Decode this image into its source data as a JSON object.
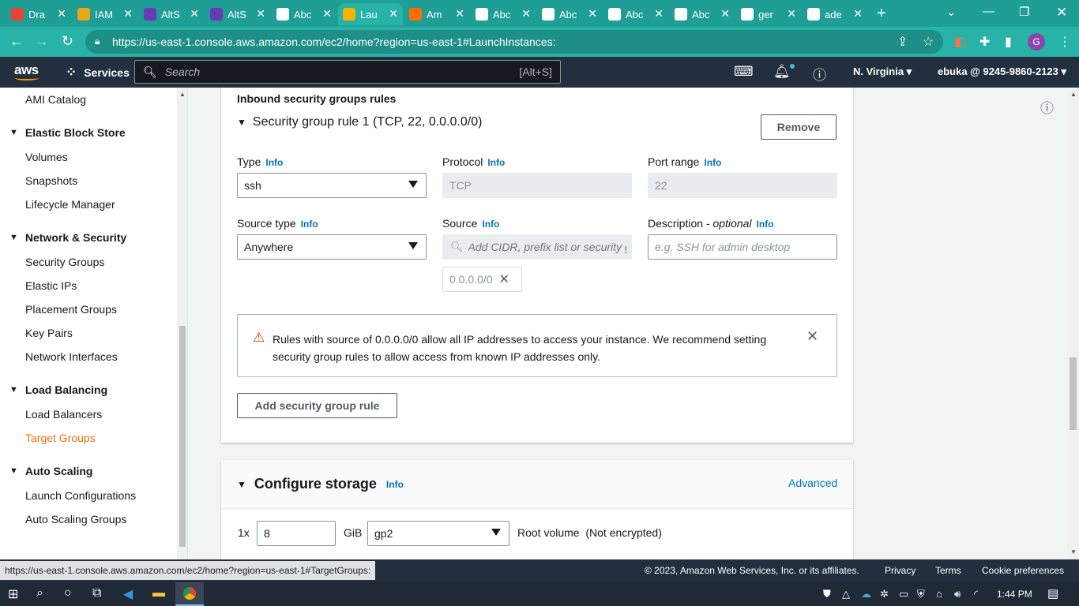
{
  "browser": {
    "tabs": [
      {
        "label": "Dra",
        "icon": "gmail-icon",
        "color": "#ea4335"
      },
      {
        "label": "IAM",
        "icon": "aws-iam-icon",
        "color": "#e6a817"
      },
      {
        "label": "AltS",
        "icon": "forms-icon",
        "color": "#673ab7"
      },
      {
        "label": "AltS",
        "icon": "forms-icon",
        "color": "#673ab7"
      },
      {
        "label": "Abc",
        "icon": "globe-icon",
        "color": "#ffffff"
      },
      {
        "label": "Lau",
        "icon": "aws-box-icon",
        "color": "#f4b400"
      },
      {
        "label": "Am",
        "icon": "aws-cube-icon",
        "color": "#ff6d00"
      },
      {
        "label": "Abc",
        "icon": "globe-icon",
        "color": "#ffffff"
      },
      {
        "label": "Abc",
        "icon": "globe-icon",
        "color": "#ffffff"
      },
      {
        "label": "Abc",
        "icon": "globe-icon",
        "color": "#ffffff"
      },
      {
        "label": "Abc",
        "icon": "globe-icon",
        "color": "#ffffff"
      },
      {
        "label": "ger",
        "icon": "google-icon",
        "color": "#ffffff"
      },
      {
        "label": "ade",
        "icon": "github-icon",
        "color": "#ffffff"
      }
    ],
    "active_tab_index": 5,
    "url": "https://us-east-1.console.aws.amazon.com/ec2/home?region=us-east-1#LaunchInstances:",
    "profile_initial": "G",
    "status_url": "https://us-east-1.console.aws.amazon.com/ec2/home?region=us-east-1#TargetGroups:"
  },
  "aws_header": {
    "logo": "aws",
    "services_label": "Services",
    "search_placeholder": "Search",
    "search_hint": "[Alt+S]",
    "region": "N. Virginia",
    "account": "ebuka @ 9245-9860-2123"
  },
  "sidebar": {
    "items": [
      {
        "type": "link",
        "label": "AMI Catalog"
      },
      {
        "type": "header",
        "label": "Elastic Block Store"
      },
      {
        "type": "link",
        "label": "Volumes"
      },
      {
        "type": "link",
        "label": "Snapshots"
      },
      {
        "type": "link",
        "label": "Lifecycle Manager"
      },
      {
        "type": "header",
        "label": "Network & Security"
      },
      {
        "type": "link",
        "label": "Security Groups"
      },
      {
        "type": "link",
        "label": "Elastic IPs"
      },
      {
        "type": "link",
        "label": "Placement Groups"
      },
      {
        "type": "link",
        "label": "Key Pairs"
      },
      {
        "type": "link",
        "label": "Network Interfaces"
      },
      {
        "type": "header",
        "label": "Load Balancing"
      },
      {
        "type": "link",
        "label": "Load Balancers"
      },
      {
        "type": "link",
        "label": "Target Groups",
        "active": true
      },
      {
        "type": "header",
        "label": "Auto Scaling"
      },
      {
        "type": "link",
        "label": "Launch Configurations"
      },
      {
        "type": "link",
        "label": "Auto Scaling Groups"
      }
    ]
  },
  "security": {
    "section_title": "Inbound security groups rules",
    "rule_title": "Security group rule 1 (TCP, 22, 0.0.0.0/0)",
    "remove_label": "Remove",
    "info_label": "Info",
    "type_label": "Type",
    "type_value": "ssh",
    "protocol_label": "Protocol",
    "protocol_value": "TCP",
    "port_label": "Port range",
    "port_value": "22",
    "source_type_label": "Source type",
    "source_type_value": "Anywhere",
    "source_label": "Source",
    "source_placeholder": "Add CIDR, prefix list or security group",
    "source_token": "0.0.0.0/0",
    "desc_label": "Description - ",
    "desc_optional": "optional",
    "desc_placeholder": "e.g. SSH for admin desktop",
    "warning_line1": "Rules with source of 0.0.0.0/0 allow all IP addresses to access your instance. We recommend setting",
    "warning_line2": "security group rules to allow access from known IP addresses only.",
    "add_rule_label": "Add security group rule"
  },
  "storage": {
    "title": "Configure storage",
    "info_label": "Info",
    "advanced_label": "Advanced",
    "count_prefix": "1x",
    "size_value": "8",
    "unit": "GiB",
    "volume_type": "gp2",
    "root_label": "Root volume  (Not encrypted)"
  },
  "footer": {
    "copyright": "© 2023, Amazon Web Services, Inc. or its affiliates.",
    "privacy": "Privacy",
    "terms": "Terms",
    "cookies": "Cookie preferences"
  },
  "taskbar": {
    "time": "1:44 PM"
  },
  "colors": {
    "chrome_teal": "#27b3a7",
    "aws_dark": "#232f3e",
    "link_blue": "#0073bb",
    "active_orange": "#ec7211",
    "warning_red": "#d13212"
  }
}
